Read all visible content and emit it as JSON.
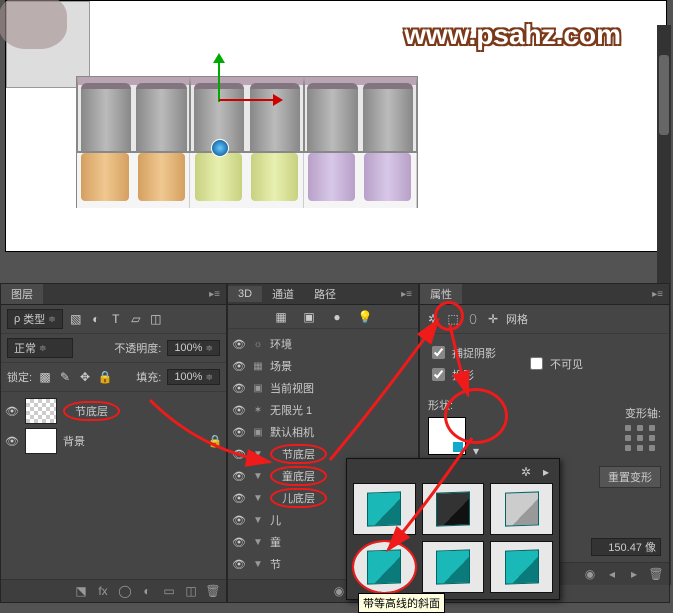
{
  "watermark": "www.psahz.com",
  "layers_panel": {
    "tab": "图层",
    "kind_label": "类型",
    "blend_mode": "正常",
    "opacity_label": "不透明度:",
    "opacity_value": "100%",
    "lock_label": "锁定:",
    "fill_label": "填充:",
    "fill_value": "100%",
    "items": [
      {
        "name": "节底层",
        "visible": true,
        "highlight": true
      },
      {
        "name": "背景",
        "visible": true,
        "white": true
      }
    ]
  },
  "panel_3d": {
    "tabs": [
      "3D",
      "通道",
      "路径"
    ],
    "items": [
      {
        "icon": "☼",
        "label": "环境"
      },
      {
        "icon": "▦",
        "label": "场景"
      },
      {
        "icon": "▣",
        "label": "当前视图",
        "indent": 1
      },
      {
        "icon": "✶",
        "label": "无限光 1",
        "indent": 1
      },
      {
        "icon": "▣",
        "label": "默认相机",
        "indent": 1
      },
      {
        "icon": "▼",
        "label": "节底层",
        "indent": 1,
        "circ": true
      },
      {
        "icon": "▼",
        "label": "童底层",
        "indent": 1,
        "circ": true
      },
      {
        "icon": "▼",
        "label": "儿底层",
        "indent": 1,
        "circ": true
      },
      {
        "icon": "▼",
        "label": "儿",
        "indent": 1
      },
      {
        "icon": "▼",
        "label": "童",
        "indent": 1
      },
      {
        "icon": "▼",
        "label": "节",
        "indent": 1
      }
    ]
  },
  "properties": {
    "tab": "属性",
    "mesh_label": "网格",
    "catch_shadow": "捕捉阴影",
    "cast_shadow": "投影",
    "invisible": "不可见",
    "shape_label": "形状:",
    "deform_axis": "变形轴:",
    "reset_deform": "重置变形",
    "coord_value": "150.47 像"
  },
  "popup_tooltip": "带等高线的斜面"
}
